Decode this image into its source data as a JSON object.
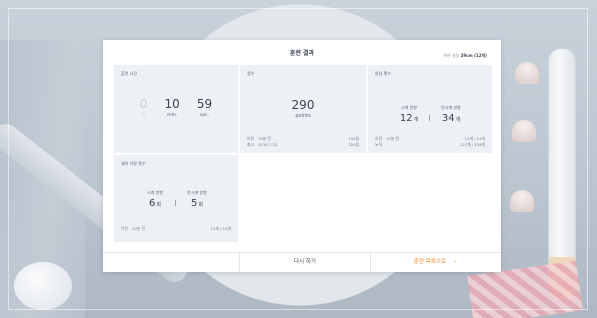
{
  "header": {
    "title": "훈련 결과",
    "screen_label": "화면 설정",
    "screen_value": "29cm (12개)"
  },
  "training_time": {
    "title": "훈련 시간",
    "hours": "0",
    "hours_label": "h",
    "minutes": "10",
    "minutes_label": "min.",
    "seconds": "59",
    "seconds_label": "sec."
  },
  "score": {
    "title": "점수",
    "value": "290",
    "unit": "points",
    "prev_label": "이전",
    "prev_when": "10분 전",
    "prev_points": "100점",
    "best_label": "최고",
    "best_when": "2016.7.22",
    "best_points": "320점"
  },
  "completed": {
    "title": "완성 횟수",
    "clockwise_label": "시계 방향",
    "clockwise_value": "12",
    "counter_label": "반시계 방향",
    "counter_value": "34",
    "unit": "개",
    "prev_label": "이전",
    "prev_when": "10분 전",
    "prev_values": "12개 / 14개",
    "total_label": "누적",
    "total_values": "127개 / 134개"
  },
  "wrong": {
    "title": "궤적 이탈 횟수",
    "clockwise_label": "시계 방향",
    "clockwise_value": "6",
    "counter_label": "반시계 방향",
    "counter_value": "5",
    "unit": "회",
    "prev_label": "이전",
    "prev_when": "10분 전",
    "prev_values": "12개 / 14개"
  },
  "buttons": {
    "retry": "다시 하기",
    "list": "훈련 목록으로",
    "list_chevron": "›"
  },
  "colors": {
    "accent": "#f08a2c",
    "card_bg": "#edf1f6",
    "text": "#3a4352"
  }
}
